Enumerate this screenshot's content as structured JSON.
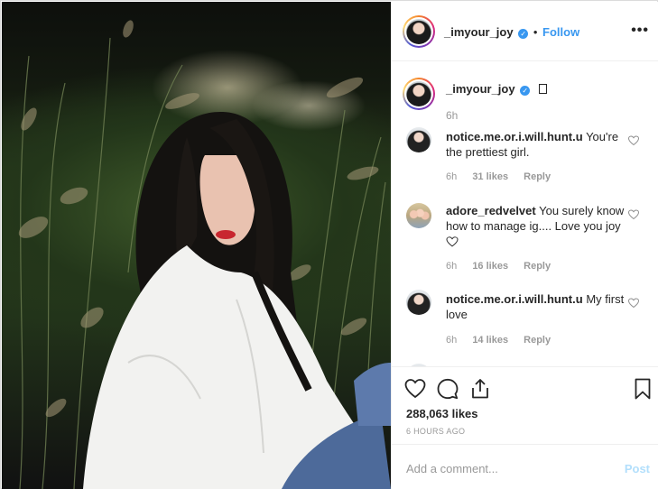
{
  "post": {
    "author": "_imyour_joy",
    "follow_label": "Follow",
    "separator": "•",
    "more_icon": "more-horizontal-icon",
    "caption_time": "6h"
  },
  "comments": [
    {
      "user": "notice.me.or.i.will.hunt.u",
      "text": "You're the prettiest girl.",
      "time": "6h",
      "likes": "31 likes",
      "reply": "Reply"
    },
    {
      "user": "adore_redvelvet",
      "text": "You surely know how to manage ig.... Love you joy",
      "emoji": "heart-emoji",
      "time": "6h",
      "likes": "16 likes",
      "reply": "Reply"
    },
    {
      "user": "notice.me.or.i.will.hunt.u",
      "text": "My first love",
      "time": "6h",
      "likes": "14 likes",
      "reply": "Reply"
    }
  ],
  "actions": {
    "like_count": "288,063 likes",
    "time_ago": "6 HOURS AGO"
  },
  "composer": {
    "placeholder": "Add a comment...",
    "post_label": "Post"
  },
  "colors": {
    "accent": "#3897f0",
    "muted": "#999999",
    "post_disabled": "#b2dffc"
  }
}
